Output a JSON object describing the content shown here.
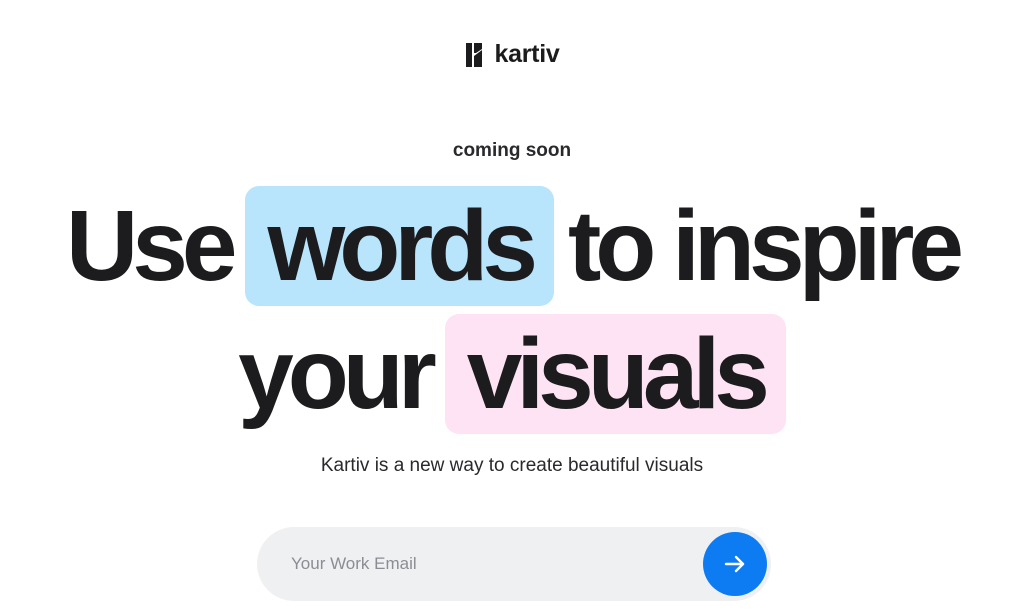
{
  "brand": {
    "name": "kartiv",
    "logo_icon": "kartiv-logo-icon"
  },
  "hero": {
    "kicker": "coming soon",
    "line1": {
      "before": "Use",
      "highlight": "words",
      "after": "to inspire"
    },
    "line2": {
      "before": "your",
      "highlight": "visuals"
    },
    "subtitle": "Kartiv is a new way to create beautiful visuals"
  },
  "signup": {
    "email_placeholder": "Your Work Email",
    "email_value": "",
    "submit_icon": "arrow-right-icon"
  },
  "colors": {
    "accent": "#0d7bf2",
    "highlight_blue": "#b8e5fb",
    "highlight_pink": "#fde3f3",
    "input_bg": "#eff0f2",
    "text": "#1c1c1f"
  }
}
